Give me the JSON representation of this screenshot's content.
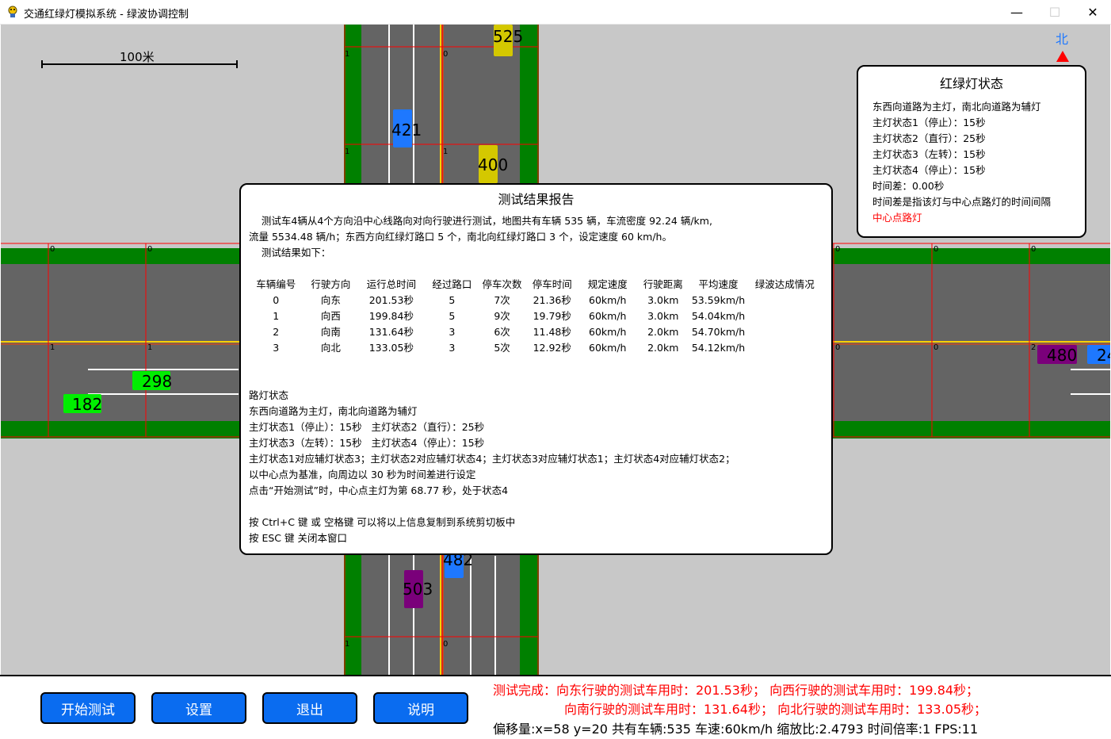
{
  "window": {
    "title": "交通红绿灯模拟系统 - 绿波协调控制",
    "minimize_glyph": "—",
    "maximize_glyph": "☐",
    "close_glyph": "✕"
  },
  "map": {
    "scale_label": "100米",
    "north_label": "北",
    "lane_markers": [
      "1",
      "0",
      "1",
      "0",
      "0",
      "0",
      "1",
      "1",
      "0",
      "0",
      "0",
      "0",
      "1",
      "1",
      "2",
      "0",
      "0"
    ],
    "vehicles": [
      {
        "id": "525",
        "color": "#d4c800"
      },
      {
        "id": "421",
        "color": "#1e78ff"
      },
      {
        "id": "400",
        "color": "#d4c800"
      },
      {
        "id": "298",
        "color": "#00ee00"
      },
      {
        "id": "182",
        "color": "#00ee00"
      },
      {
        "id": "480",
        "color": "#7a007a"
      },
      {
        "id": "24",
        "color": "#1e78ff"
      },
      {
        "id": "482",
        "color": "#1e78ff"
      },
      {
        "id": "503",
        "color": "#7a007a"
      }
    ],
    "colors": {
      "road": "#646464",
      "grass": "#008000",
      "background": "#c8c8c8",
      "boundary": "#ff0000",
      "center": "#ffd000"
    }
  },
  "light_panel": {
    "title": "红绿灯状态",
    "lines": [
      "东西向道路为主灯，南北向道路为辅灯",
      "主灯状态1（停止）：15秒",
      "主灯状态2（直行）：25秒",
      "主灯状态3（左转）：15秒",
      "主灯状态4（停止）：15秒",
      "时间差：0.00秒",
      "时间差是指该灯与中心点路灯的时间间隔"
    ],
    "highlight": "中心点路灯"
  },
  "report": {
    "title": "测试结果报告",
    "intro": [
      "    测试车4辆从4个方向沿中心线路向对向行驶进行测试，地图共有车辆 535 辆，车流密度 92.24 辆/km,",
      "流量 5534.48 辆/h；东西方向红绿灯路口 5 个，南北向红绿灯路口 3 个，设定速度 60 km/h。",
      "    测试结果如下："
    ],
    "table": {
      "headers": [
        "车辆编号",
        "行驶方向",
        "运行总时间",
        "经过路口",
        "停车次数",
        "停车时间",
        "规定速度",
        "行驶距离",
        "平均速度",
        "绿波达成情况"
      ],
      "rows": [
        [
          "0",
          "向东",
          "201.53秒",
          "5",
          "7次",
          "21.36秒",
          "60km/h",
          "3.0km",
          "53.59km/h",
          ""
        ],
        [
          "1",
          "向西",
          "199.84秒",
          "5",
          "9次",
          "19.79秒",
          "60km/h",
          "3.0km",
          "54.04km/h",
          ""
        ],
        [
          "2",
          "向南",
          "131.64秒",
          "3",
          "6次",
          "11.48秒",
          "60km/h",
          "2.0km",
          "54.70km/h",
          ""
        ],
        [
          "3",
          "向北",
          "133.05秒",
          "3",
          "5次",
          "12.92秒",
          "60km/h",
          "2.0km",
          "54.12km/h",
          ""
        ]
      ]
    },
    "lights_section": [
      "路灯状态",
      "东西向道路为主灯，南北向道路为辅灯",
      "主灯状态1（停止）：15秒   主灯状态2（直行）：25秒",
      "主灯状态3（左转）：15秒   主灯状态4（停止）：15秒",
      "主灯状态1对应辅灯状态3；主灯状态2对应辅灯状态4；主灯状态3对应辅灯状态1；主灯状态4对应辅灯状态2；",
      "以中心点为基准，向周边以 30 秒为时间差进行设定",
      "点击“开始测试”时，中心点主灯为第 68.77 秒，处于状态4"
    ],
    "footer": [
      "按 Ctrl+C 键 或 空格键 可以将以上信息复制到系统剪切板中",
      "按 ESC 键 关闭本窗口"
    ]
  },
  "buttons": {
    "start": "开始测试",
    "settings": "设置",
    "exit": "退出",
    "help": "说明"
  },
  "status": {
    "line1": "测试完成：向东行驶的测试车用时：201.53秒；  向西行驶的测试车用时：199.84秒；",
    "line2": "向南行驶的测试车用时：131.64秒；  向北行驶的测试车用时：133.05秒；",
    "line3": "偏移量:x=58 y=20 共有车辆:535  车速:60km/h 缩放比:2.4793 时间倍率:1 FPS:11"
  }
}
